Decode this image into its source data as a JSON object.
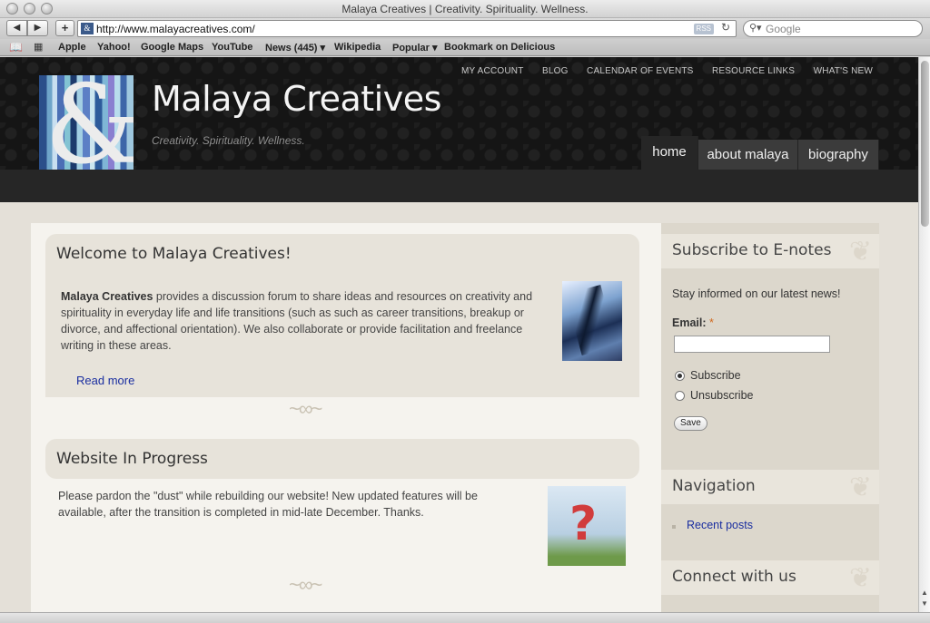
{
  "window": {
    "title": "Malaya Creatives | Creativity. Spirituality. Wellness."
  },
  "toolbar": {
    "back": "◀",
    "forward": "▶",
    "add": "+",
    "url": "http://www.malayacreatives.com/",
    "rss": "RSS",
    "reload": "↻",
    "search_placeholder": "Google"
  },
  "bookmarks": {
    "items": [
      "Apple",
      "Yahoo!",
      "Google Maps",
      "YouTube",
      "News (445) ▾",
      "Wikipedia",
      "Popular ▾",
      "Bookmark on Delicious"
    ]
  },
  "site": {
    "title": "Malaya Creatives",
    "tagline": "Creativity. Spirituality. Wellness.",
    "logo_mark": "&",
    "top_nav": [
      "MY ACCOUNT",
      "BLOG",
      "CALENDAR OF EVENTS",
      "RESOURCE LINKS",
      "WHAT'S NEW"
    ],
    "main_nav": [
      "home",
      "about malaya",
      "biography"
    ]
  },
  "main": {
    "welcome": {
      "title": "Welcome to Malaya Creatives!",
      "bold": "Malaya Creatives",
      "lines": [
        " provides a discussion forum to share ideas and resources on creativity and",
        "spirituality in everyday life and life transitions (such as such as career transitions, breakup or",
        "divorce, and affectional orientation). We also collaborate or provide facilitation and freelance",
        "writing in these areas."
      ],
      "read_more": "Read more"
    },
    "progress": {
      "title": "Website In Progress",
      "lines": [
        "Please pardon the \"dust\" while rebuilding our website!  New updated features will be",
        "available, after the transition is completed in mid-late December. Thanks."
      ]
    },
    "flourish": "~∞~"
  },
  "sidebar": {
    "subscribe": {
      "title": "Subscribe to E-notes",
      "intro": "Stay informed on our latest news!",
      "email_label": "Email:",
      "required_mark": "*",
      "email_value": "",
      "options": [
        "Subscribe",
        "Unsubscribe"
      ],
      "selected": "Subscribe",
      "save": "Save"
    },
    "navigation": {
      "title": "Navigation",
      "links": [
        "Recent posts"
      ]
    },
    "connect": {
      "title": "Connect with us"
    },
    "swirl": "❦"
  },
  "colors": {
    "header_bg": "#151515",
    "link": "#1a2ea0",
    "panel": "#e7e3da",
    "required": "#d2691e"
  },
  "icons": {
    "bookmarks_book": "book-icon",
    "bookmarks_grid": "grid-icon",
    "search": "magnifier-icon"
  }
}
